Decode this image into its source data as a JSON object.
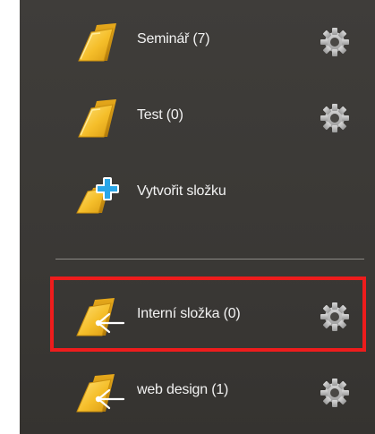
{
  "folders": [
    {
      "label": "Seminář (7)",
      "icon": "folder-icon",
      "settings_icon": "gear-icon"
    },
    {
      "label": "Test (0)",
      "icon": "folder-icon",
      "settings_icon": "gear-icon"
    }
  ],
  "create_folder": {
    "label": "Vytvořit složku",
    "icon": "new-folder-plus-icon"
  },
  "shared_folders": [
    {
      "label": "Interní složka (0)",
      "icon": "shared-folder-icon",
      "settings_icon": "gear-icon",
      "highlighted": true
    },
    {
      "label": "web design (1)",
      "icon": "shared-folder-icon",
      "settings_icon": "gear-icon"
    }
  ],
  "colors": {
    "panel_bg": "#3c3a37",
    "folder": "#f5c02c",
    "plus": "#2aa6e8",
    "highlight": "#ee1c1c",
    "text": "#f2f2f2"
  }
}
